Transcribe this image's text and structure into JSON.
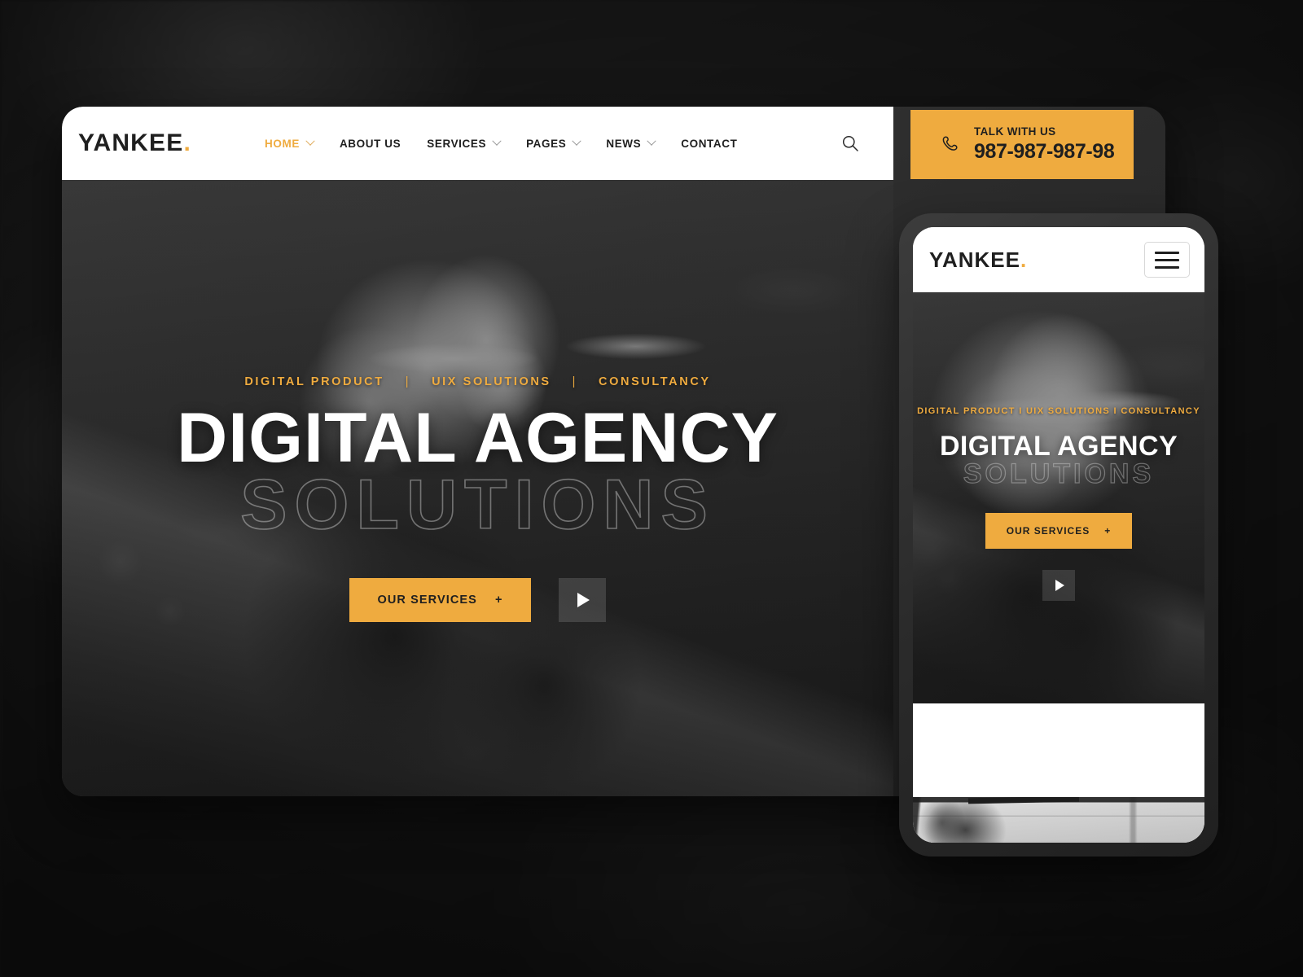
{
  "theme": {
    "accent": "#efab3f",
    "dark": "#1f1f1f",
    "white": "#ffffff",
    "page_bg": "#1c1c1c"
  },
  "desktop": {
    "brand": {
      "name": "YANKEE",
      "dot": "."
    },
    "nav": [
      {
        "label": "HOME",
        "has_caret": true,
        "active": true
      },
      {
        "label": "ABOUT US",
        "has_caret": false,
        "active": false
      },
      {
        "label": "SERVICES",
        "has_caret": true,
        "active": false
      },
      {
        "label": "PAGES",
        "has_caret": true,
        "active": false
      },
      {
        "label": "NEWS",
        "has_caret": true,
        "active": false
      },
      {
        "label": "CONTACT",
        "has_caret": false,
        "active": false
      }
    ],
    "search_icon": "search-icon",
    "hero": {
      "eyebrow": [
        "DIGITAL PRODUCT",
        "UIX SOLUTIONS",
        "CONSULTANCY"
      ],
      "separator": "|",
      "headline_solid": "DIGITAL AGENCY",
      "headline_outline": "SOLUTIONS",
      "cta_label": "OUR SERVICES",
      "cta_plus": "+",
      "play_icon": "play-icon"
    }
  },
  "talk_badge": {
    "phone_icon": "phone-icon",
    "label": "TALK WITH US",
    "number": "987-987-987-98"
  },
  "mobile": {
    "brand": {
      "name": "YANKEE",
      "dot": "."
    },
    "menu_icon": "hamburger-menu-icon",
    "hero": {
      "eyebrow": "DIGITAL PRODUCT I UIX SOLUTIONS I CONSULTANCY",
      "headline_solid": "DIGITAL AGENCY",
      "headline_outline": "SOLUTIONS",
      "cta_label": "OUR SERVICES",
      "cta_plus": "+",
      "play_icon": "play-icon"
    }
  }
}
